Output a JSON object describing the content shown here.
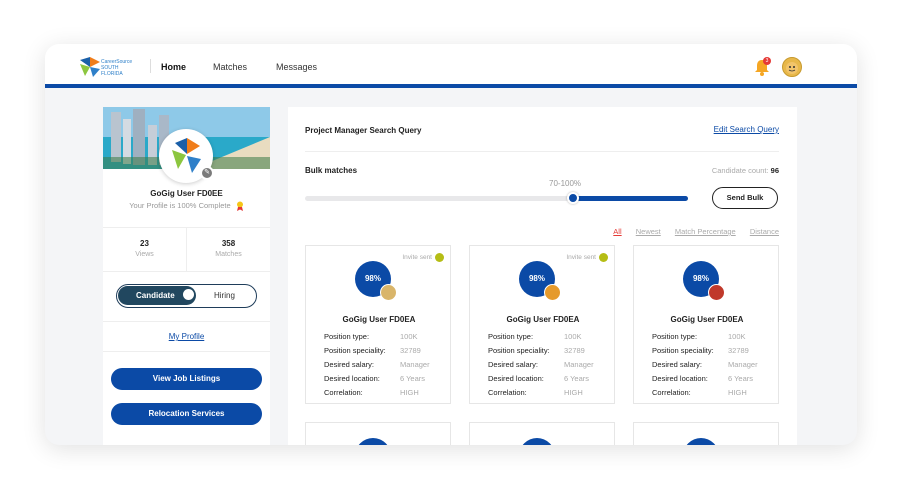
{
  "header": {
    "brand": "CareerSource SOUTH FLORIDA",
    "nav": [
      {
        "label": "Home",
        "active": true
      },
      {
        "label": "Matches",
        "active": false
      },
      {
        "label": "Messages",
        "active": false
      }
    ],
    "notification_count": "3",
    "accent": "#0b4aa6"
  },
  "sidebar": {
    "user_name": "GoGig User FD0EE",
    "profile_status": "Your Profile is 100% Complete",
    "stats": [
      {
        "value": "23",
        "label": "Views"
      },
      {
        "value": "358",
        "label": "Matches"
      }
    ],
    "toggle": {
      "on": "Candidate",
      "off": "Hiring"
    },
    "my_profile": "My Profile",
    "buttons": [
      "View Job Listings",
      "Relocation Services"
    ]
  },
  "main": {
    "query_title": "Project Manager Search Query",
    "edit_link": "Edit Search Query",
    "bulk_label": "Bulk matches",
    "candidate_count_label": "Candidate count:",
    "candidate_count": "96",
    "range_label": "70-100%",
    "range_min": 70,
    "range_max": 100,
    "send_bulk": "Send Bulk",
    "filters": [
      "All",
      "Newest",
      "Match Percentage",
      "Distance"
    ],
    "active_filter": "All"
  },
  "cards": [
    {
      "match": "98%",
      "invite": "Invite sent",
      "avatar": "tiger-avatar",
      "avatar_color": "#d9b56a",
      "name": "GoGig User FD0EA",
      "fields": [
        [
          "Position type:",
          "100K"
        ],
        [
          "Position speciality:",
          "32789"
        ],
        [
          "Desired salary:",
          "Manager"
        ],
        [
          "Desired location:",
          "6 Years"
        ],
        [
          "Correlation:",
          "HIGH"
        ]
      ]
    },
    {
      "match": "98%",
      "invite": "Invite sent",
      "avatar": "girl-avatar",
      "avatar_color": "#e59a2c",
      "name": "GoGig User FD0EA",
      "fields": [
        [
          "Position type:",
          "100K"
        ],
        [
          "Position speciality:",
          "32789"
        ],
        [
          "Desired salary:",
          "Manager"
        ],
        [
          "Desired location:",
          "6 Years"
        ],
        [
          "Correlation:",
          "HIGH"
        ]
      ]
    },
    {
      "match": "98%",
      "invite": "",
      "avatar": "man-avatar",
      "avatar_color": "#c0392b",
      "name": "GoGig User FD0EA",
      "fields": [
        [
          "Position type:",
          "100K"
        ],
        [
          "Position speciality:",
          "32789"
        ],
        [
          "Desired salary:",
          "Manager"
        ],
        [
          "Desired location:",
          "6 Years"
        ],
        [
          "Correlation:",
          "HIGH"
        ]
      ]
    }
  ]
}
